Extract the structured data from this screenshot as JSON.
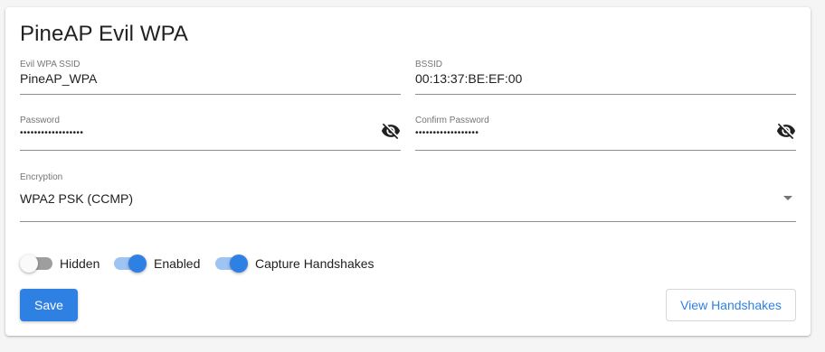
{
  "card": {
    "title": "PineAP Evil WPA"
  },
  "fields": {
    "ssid": {
      "label": "Evil WPA SSID",
      "value": "PineAP_WPA"
    },
    "bssid": {
      "label": "BSSID",
      "value": "00:13:37:BE:EF:00"
    },
    "password": {
      "label": "Password",
      "value": "••••••••••••••••••",
      "visibility_icon": "eye-off-icon"
    },
    "confirm_password": {
      "label": "Confirm Password",
      "value": "••••••••••••••••••",
      "visibility_icon": "eye-off-icon"
    },
    "encryption": {
      "label": "Encryption",
      "value": "WPA2 PSK (CCMP)",
      "dropdown_icon": "caret-down-icon"
    }
  },
  "toggles": [
    {
      "label": "Hidden",
      "state": "off"
    },
    {
      "label": "Enabled",
      "state": "on"
    },
    {
      "label": "Capture Handshakes",
      "state": "on"
    }
  ],
  "buttons": {
    "save": "Save",
    "view_handshakes": "View Handshakes"
  },
  "colors": {
    "accent": "#2f80e3",
    "accent_track": "#9dc4f2",
    "off_track": "#9e9e9e",
    "background": "#f5f5f5",
    "card": "#ffffff"
  }
}
